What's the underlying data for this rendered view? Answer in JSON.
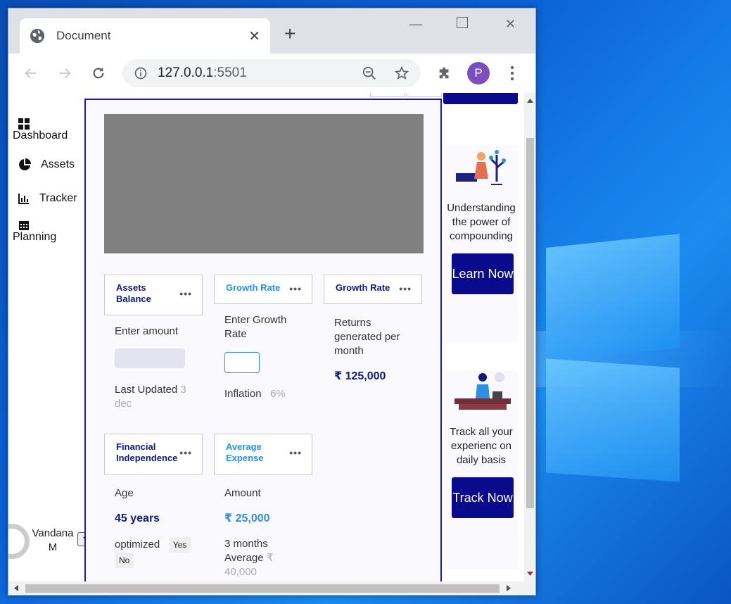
{
  "browser": {
    "tab_title": "Document",
    "url_host": "127.0.0.1",
    "url_port": ":5501",
    "profile_initial": "P"
  },
  "sidebar": {
    "items": [
      {
        "label": "Dashboard",
        "icon": "grid-icon"
      },
      {
        "label": "Assets",
        "icon": "pie-chart-icon"
      },
      {
        "label": "Tracker",
        "icon": "bar-chart-icon"
      },
      {
        "label": "Planning",
        "icon": "calendar-icon"
      }
    ],
    "user": {
      "name": "Vandana M"
    }
  },
  "cards": {
    "assets_balance": {
      "title": "Assets Balance",
      "prompt": "Enter amount",
      "updated_label": "Last Updated",
      "updated_value": "3 dec"
    },
    "growth_rate_input": {
      "title": "Growth Rate",
      "prompt": "Enter Growth Rate",
      "inflation_label": "Inflation",
      "inflation_value": "6%"
    },
    "growth_rate_returns": {
      "title": "Growth Rate",
      "text": "Returns generated per month",
      "value": "₹ 125,000"
    },
    "financial_independence": {
      "title": "Financial Independence",
      "age_label": "Age",
      "age_value": "45 years",
      "optimized_label": "optimized",
      "yes": "Yes",
      "no": "No"
    },
    "average_expense": {
      "title": "Average Expense",
      "amount_label": "Amount",
      "amount_value": "₹ 25,000",
      "avg_label": "3 months Average",
      "avg_value": "₹ 40,000"
    }
  },
  "promos": [
    {
      "text": "Understanding the power of compounding",
      "button": "Learn Now"
    },
    {
      "text": "Track all your experienc on daily basis",
      "button": "Track Now"
    }
  ],
  "colors": {
    "accent": "#0a0a8c",
    "blue": "#2d8fe0",
    "navy": "#0d1b7a"
  }
}
